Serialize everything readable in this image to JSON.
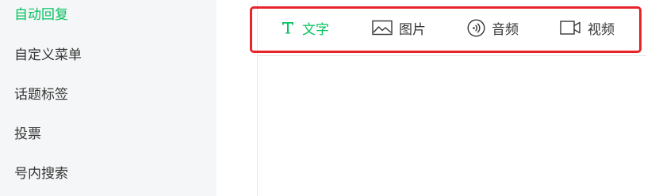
{
  "sidebar": {
    "items": [
      {
        "label": "自动回复"
      },
      {
        "label": "自定义菜单"
      },
      {
        "label": "话题标签"
      },
      {
        "label": "投票"
      },
      {
        "label": "号内搜索"
      }
    ]
  },
  "toolbar": {
    "tabs": [
      {
        "label": "文字",
        "icon": "text-icon"
      },
      {
        "label": "图片",
        "icon": "image-icon"
      },
      {
        "label": "音频",
        "icon": "audio-icon"
      },
      {
        "label": "视频",
        "icon": "video-icon"
      }
    ]
  },
  "colors": {
    "accent": "#07c160",
    "highlight": "#e8242a",
    "text": "#353535",
    "sidebar_bg": "#f5f6f7"
  }
}
